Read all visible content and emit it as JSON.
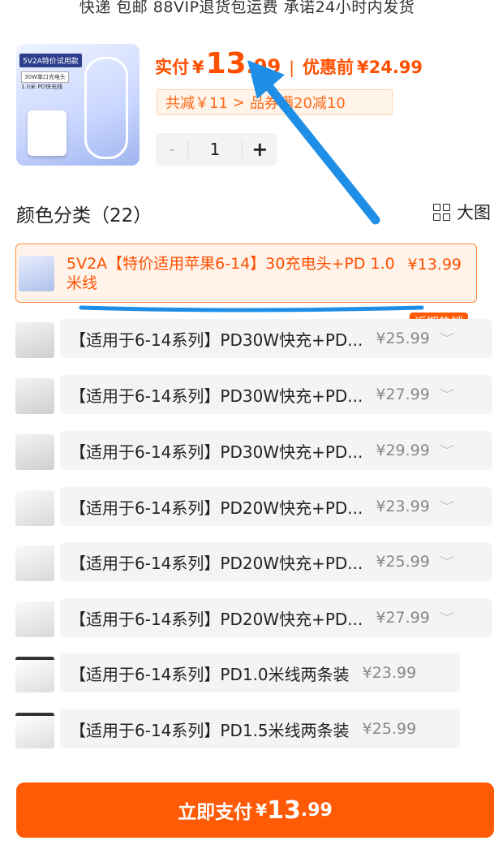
{
  "top_note": "快递 包邮 88VIP退货包运费 承诺24小时内发货",
  "product": {
    "thumb_badge": "5V2A特价试用款",
    "thumb_tag1": "30W单口充电头",
    "thumb_tag2": "1.0米 PD快充线",
    "price_label": "实付",
    "currency": "¥",
    "price_int": "13",
    "price_dec": ".99",
    "separator": "|",
    "before_label": "优惠前",
    "before_price": "¥24.99",
    "discount_total": "共减￥11",
    "discount_arrow": ">",
    "coupon_text": "品券满20减10"
  },
  "quantity": {
    "minus": "-",
    "value": "1",
    "plus": "+"
  },
  "section": {
    "title": "颜色分类（22）",
    "big_view": "大图"
  },
  "selected_sku": {
    "name": "5V2A【特价适用苹果6-14】30充电头+PD 1.0米线",
    "price": "¥13.99"
  },
  "hot_badge": "近期热销",
  "skus": [
    {
      "name": "【适用于6-14系列】PD30W快充+PD...",
      "price": "¥25.99",
      "chev": "﹀"
    },
    {
      "name": "【适用于6-14系列】PD30W快充+PD...",
      "price": "¥27.99",
      "chev": "﹀"
    },
    {
      "name": "【适用于6-14系列】PD30W快充+PD...",
      "price": "¥29.99",
      "chev": "﹀"
    },
    {
      "name": "【适用于6-14系列】PD20W快充+PD...",
      "price": "¥23.99",
      "chev": "﹀"
    },
    {
      "name": "【适用于6-14系列】PD20W快充+PD...",
      "price": "¥25.99",
      "chev": "﹀"
    },
    {
      "name": "【适用于6-14系列】PD20W快充+PD...",
      "price": "¥27.99",
      "chev": "﹀"
    },
    {
      "name": "【适用于6-14系列】PD1.0米线两条装",
      "price": "¥23.99"
    },
    {
      "name": "【适用于6-14系列】PD1.5米线两条装",
      "price": "¥25.99"
    }
  ],
  "pay_button": {
    "label": "立即支付",
    "currency": "¥",
    "int": "13",
    "dec": ".99"
  },
  "colors": {
    "accent": "#ff5000",
    "annotation": "#1e8ee6"
  }
}
